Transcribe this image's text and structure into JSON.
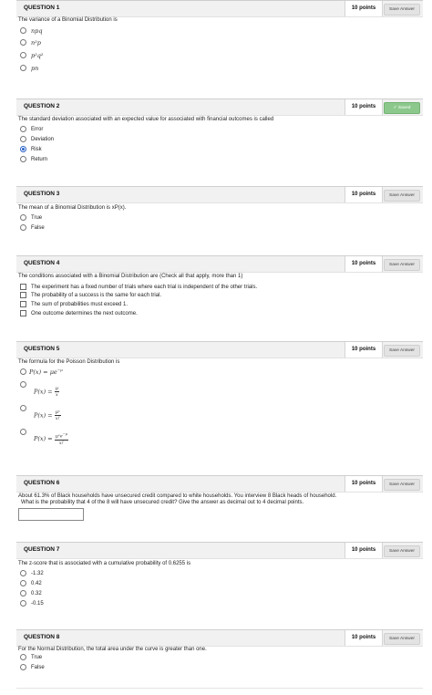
{
  "questions": [
    {
      "title": "QUESTION 1",
      "points": "10 points",
      "save": "Save Answer",
      "text": "The variance of a Binomial Distribution is",
      "options": [
        "npq",
        "n²p",
        "p²q²",
        "pn"
      ]
    },
    {
      "title": "QUESTION 2",
      "points": "10 points",
      "save": "✓ Saved",
      "text": "The standard deviation associated with an expected value for associated with financial outcomes is called",
      "options": [
        "Error",
        "Deviation",
        "Risk",
        "Return"
      ]
    },
    {
      "title": "QUESTION 3",
      "points": "10 points",
      "save": "Save Answer",
      "text": "The mean of a Binomial Distribution is xP(x).",
      "options": [
        "True",
        "False"
      ]
    },
    {
      "title": "QUESTION 4",
      "points": "10 points",
      "save": "Save Answer",
      "text": "The conditions associated with a Binomial Distribution are (Check all that apply, more than 1)",
      "options": [
        "The experiment has a fixed number of trials where each trial is independent of the other trials.",
        "The probability of a success is the same for each trial.",
        "The sum of probabilities must exceed 1.",
        "One outcome determines the next outcome."
      ]
    },
    {
      "title": "QUESTION 5",
      "points": "10 points",
      "save": "Save Answer",
      "text": "The formula for the Poisson Distribution is",
      "options": [
        "P(x) = μe",
        "P(x) =",
        "P(x) =",
        "P(x) ="
      ],
      "math": {
        "o1_exp": "−μ",
        "o2_num": "μ",
        "o2_den": "x",
        "o3_num": "μˣ",
        "o3_den": "x!",
        "o4_num": "μˣe",
        "o4_exp": "−μ",
        "o4_den": "x!"
      }
    },
    {
      "title": "QUESTION 6",
      "points": "10 points",
      "save": "Save Answer",
      "text": "About 61.3% of Black households have unsecured credit compared to white households.  You interview 8 Black heads of household.",
      "text2": "What is the probability that 4 of the 8 will have unsecured credit? Give the answer as decimal out to 4 decimal points.",
      "answer": ""
    },
    {
      "title": "QUESTION 7",
      "points": "10 points",
      "save": "Save Answer",
      "text": "The z-score that is associated with a cumulative probability of 0.6255 is",
      "options": [
        "-1.32",
        "0.42",
        "0.32",
        "-0.15"
      ]
    },
    {
      "title": "QUESTION 8",
      "points": "10 points",
      "save": "Save Answer",
      "text": "For the Normal Distribution, the total area under the curve is greater than one.",
      "options": [
        "True",
        "False"
      ]
    }
  ]
}
